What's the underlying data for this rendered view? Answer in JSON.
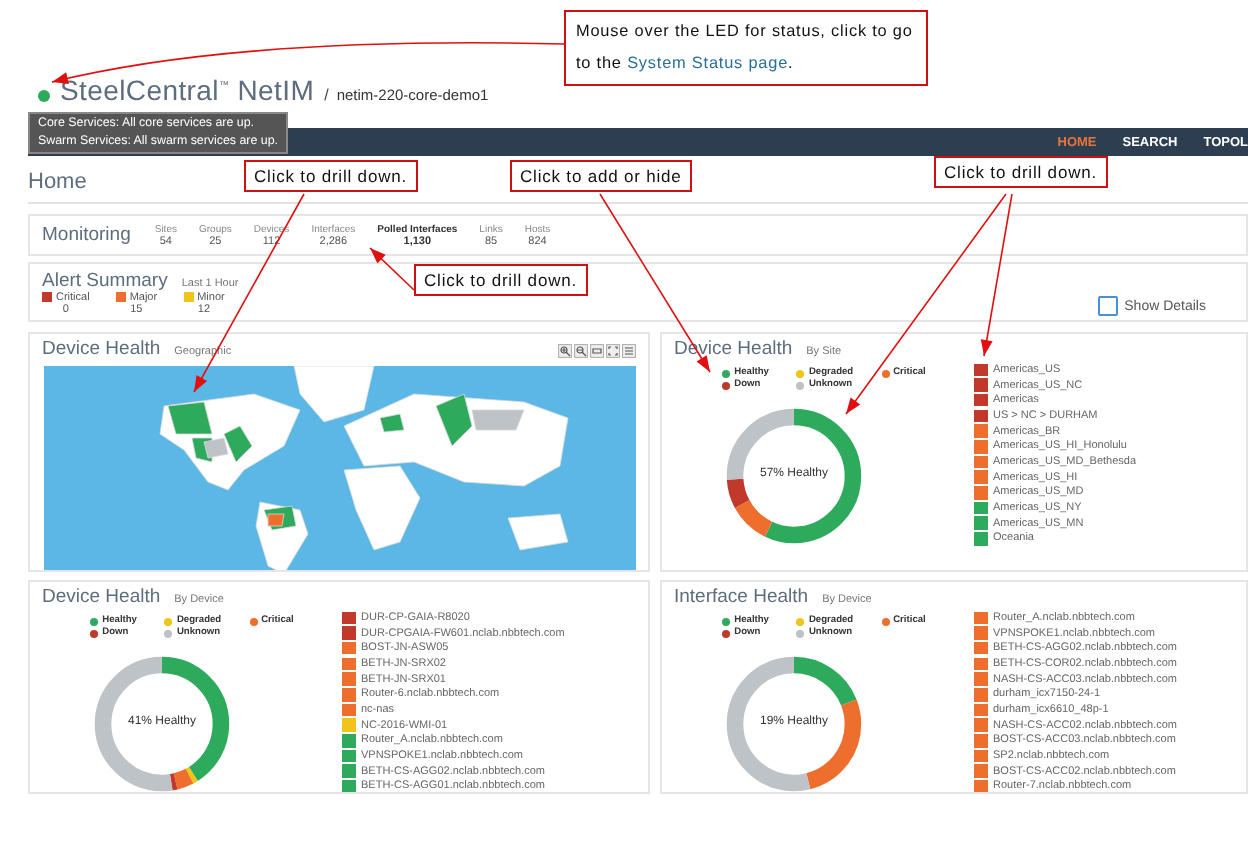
{
  "header": {
    "product": "SteelCentral",
    "trademark": "™",
    "product_suffix": "NetIM",
    "separator": "/",
    "server": "netim-220-core-demo1"
  },
  "tooltip": {
    "lines": [
      "Core Services: All core services are up.",
      "Swarm Services: All swarm services are up."
    ]
  },
  "nav": [
    {
      "label": "HOME",
      "selected": true
    },
    {
      "label": "SEARCH",
      "selected": false
    },
    {
      "label": "TOPOL",
      "selected": false
    }
  ],
  "page_title": "Home",
  "monitoring": {
    "title": "Monitoring",
    "stats": [
      {
        "label": "Sites",
        "value": "54",
        "emphasized": false
      },
      {
        "label": "Groups",
        "value": "25",
        "emphasized": false
      },
      {
        "label": "Devices",
        "value": "112",
        "emphasized": false
      },
      {
        "label": "Interfaces",
        "value": "2,286",
        "emphasized": false
      },
      {
        "label": "Polled Interfaces",
        "value": "1,130",
        "emphasized": true
      },
      {
        "label": "Links",
        "value": "85",
        "emphasized": false
      },
      {
        "label": "Hosts",
        "value": "824",
        "emphasized": false
      }
    ]
  },
  "alert_summary": {
    "title": "Alert Summary",
    "period": "Last 1 Hour",
    "severities": [
      {
        "label": "Critical",
        "count": "0",
        "color": "#c0392b"
      },
      {
        "label": "Major",
        "count": "15",
        "color": "#ee6e2d"
      },
      {
        "label": "Minor",
        "count": "12",
        "color": "#f0c419"
      }
    ],
    "show_details": {
      "label": "Show Details",
      "checked": false
    }
  },
  "panels": [
    {
      "kind": "map",
      "title": "Device Health",
      "subtitle": "Geographic"
    },
    {
      "kind": "donut",
      "title": "Device Health",
      "subtitle": "By Site",
      "center_label": "57% Healthy",
      "legend": [
        {
          "label": "Healthy",
          "color": "#2eaa5c"
        },
        {
          "label": "Degraded",
          "color": "#f0c419"
        },
        {
          "label": "Critical",
          "color": "#ee6e2d"
        },
        {
          "label": "Down",
          "color": "#c0392b"
        },
        {
          "label": "Unknown",
          "color": "#bdc3c7"
        }
      ],
      "segments": [
        {
          "kind": "healthy",
          "level": 0.57
        },
        {
          "kind": "critical",
          "level": 0.1
        },
        {
          "kind": "down",
          "level": 0.07
        },
        {
          "kind": "unknown",
          "level": 0.26
        }
      ],
      "items": [
        {
          "label": "Americas_US",
          "color": "#c0392b"
        },
        {
          "label": "Americas_US_NC",
          "color": "#c0392b"
        },
        {
          "label": "Americas",
          "color": "#c0392b"
        },
        {
          "label": "US > NC > DURHAM",
          "color": "#c0392b"
        },
        {
          "label": "Americas_BR",
          "color": "#ee6e2d"
        },
        {
          "label": "Americas_US_HI_Honolulu",
          "color": "#ee6e2d"
        },
        {
          "label": "Americas_US_MD_Bethesda",
          "color": "#ee6e2d"
        },
        {
          "label": "Americas_US_HI",
          "color": "#ee6e2d"
        },
        {
          "label": "Americas_US_MD",
          "color": "#ee6e2d"
        },
        {
          "label": "Americas_US_NY",
          "color": "#2eaa5c"
        },
        {
          "label": "Americas_US_MN",
          "color": "#2eaa5c"
        },
        {
          "label": "Oceania",
          "color": "#2eaa5c"
        }
      ]
    },
    {
      "kind": "donut",
      "title": "Device Health",
      "subtitle": "By Device",
      "center_label": "41% Healthy",
      "legend": [
        {
          "label": "Healthy",
          "color": "#2eaa5c"
        },
        {
          "label": "Degraded",
          "color": "#f0c419"
        },
        {
          "label": "Critical",
          "color": "#ee6e2d"
        },
        {
          "label": "Down",
          "color": "#c0392b"
        },
        {
          "label": "Unknown",
          "color": "#bdc3c7"
        }
      ],
      "segments": [
        {
          "kind": "healthy",
          "level": 0.41
        },
        {
          "kind": "degraded",
          "level": 0.012
        },
        {
          "kind": "critical",
          "level": 0.04
        },
        {
          "kind": "down",
          "level": 0.012
        },
        {
          "kind": "unknown",
          "level": 0.526
        }
      ],
      "items": [
        {
          "label": "DUR-CP-GAIA-R8020",
          "color": "#c0392b"
        },
        {
          "label": "DUR-CPGAIA-FW601.nclab.nbbtech.com",
          "color": "#c0392b"
        },
        {
          "label": "BOST-JN-ASW05",
          "color": "#ee6e2d"
        },
        {
          "label": "BETH-JN-SRX02",
          "color": "#ee6e2d"
        },
        {
          "label": "BETH-JN-SRX01",
          "color": "#ee6e2d"
        },
        {
          "label": "Router-6.nclab.nbbtech.com",
          "color": "#ee6e2d"
        },
        {
          "label": "nc-nas",
          "color": "#ee6e2d"
        },
        {
          "label": "NC-2016-WMI-01",
          "color": "#f0c419"
        },
        {
          "label": "Router_A.nclab.nbbtech.com",
          "color": "#2eaa5c"
        },
        {
          "label": "VPNSPOKE1.nclab.nbbtech.com",
          "color": "#2eaa5c"
        },
        {
          "label": "BETH-CS-AGG02.nclab.nbbtech.com",
          "color": "#2eaa5c"
        },
        {
          "label": "BETH-CS-AGG01.nclab.nbbtech.com",
          "color": "#2eaa5c"
        }
      ]
    },
    {
      "kind": "donut",
      "title": "Interface Health",
      "subtitle": "By Device",
      "center_label": "19% Healthy",
      "legend": [
        {
          "label": "Healthy",
          "color": "#2eaa5c"
        },
        {
          "label": "Degraded",
          "color": "#f0c419"
        },
        {
          "label": "Critical",
          "color": "#ee6e2d"
        },
        {
          "label": "Down",
          "color": "#c0392b"
        },
        {
          "label": "Unknown",
          "color": "#bdc3c7"
        }
      ],
      "segments": [
        {
          "kind": "healthy",
          "level": 0.19
        },
        {
          "kind": "critical",
          "level": 0.27
        },
        {
          "kind": "unknown",
          "level": 0.54
        }
      ],
      "items": [
        {
          "label": "Router_A.nclab.nbbtech.com",
          "color": "#ee6e2d"
        },
        {
          "label": "VPNSPOKE1.nclab.nbbtech.com",
          "color": "#ee6e2d"
        },
        {
          "label": "BETH-CS-AGG02.nclab.nbbtech.com",
          "color": "#ee6e2d"
        },
        {
          "label": "BETH-CS-COR02.nclab.nbbtech.com",
          "color": "#ee6e2d"
        },
        {
          "label": "NASH-CS-ACC03.nclab.nbbtech.com",
          "color": "#ee6e2d"
        },
        {
          "label": "durham_icx7150-24-1",
          "color": "#ee6e2d"
        },
        {
          "label": "durham_icx6610_48p-1",
          "color": "#ee6e2d"
        },
        {
          "label": "NASH-CS-ACC02.nclab.nbbtech.com",
          "color": "#ee6e2d"
        },
        {
          "label": "BOST-CS-ACC03.nclab.nbbtech.com",
          "color": "#ee6e2d"
        },
        {
          "label": "SP2.nclab.nbbtech.com",
          "color": "#ee6e2d"
        },
        {
          "label": "BOST-CS-ACC02.nclab.nbbtech.com",
          "color": "#ee6e2d"
        },
        {
          "label": "Router-7.nclab.nbbtech.com",
          "color": "#ee6e2d"
        }
      ]
    }
  ],
  "annotations": [
    {
      "text": "Mouse over the LED for status, click to go to the ",
      "link": "System Status page",
      "text_after": "."
    },
    {
      "text": "Click to drill down."
    },
    {
      "text": "Click to add or hide"
    },
    {
      "text": "Click to drill down."
    },
    {
      "text": "Click to drill down."
    }
  ]
}
